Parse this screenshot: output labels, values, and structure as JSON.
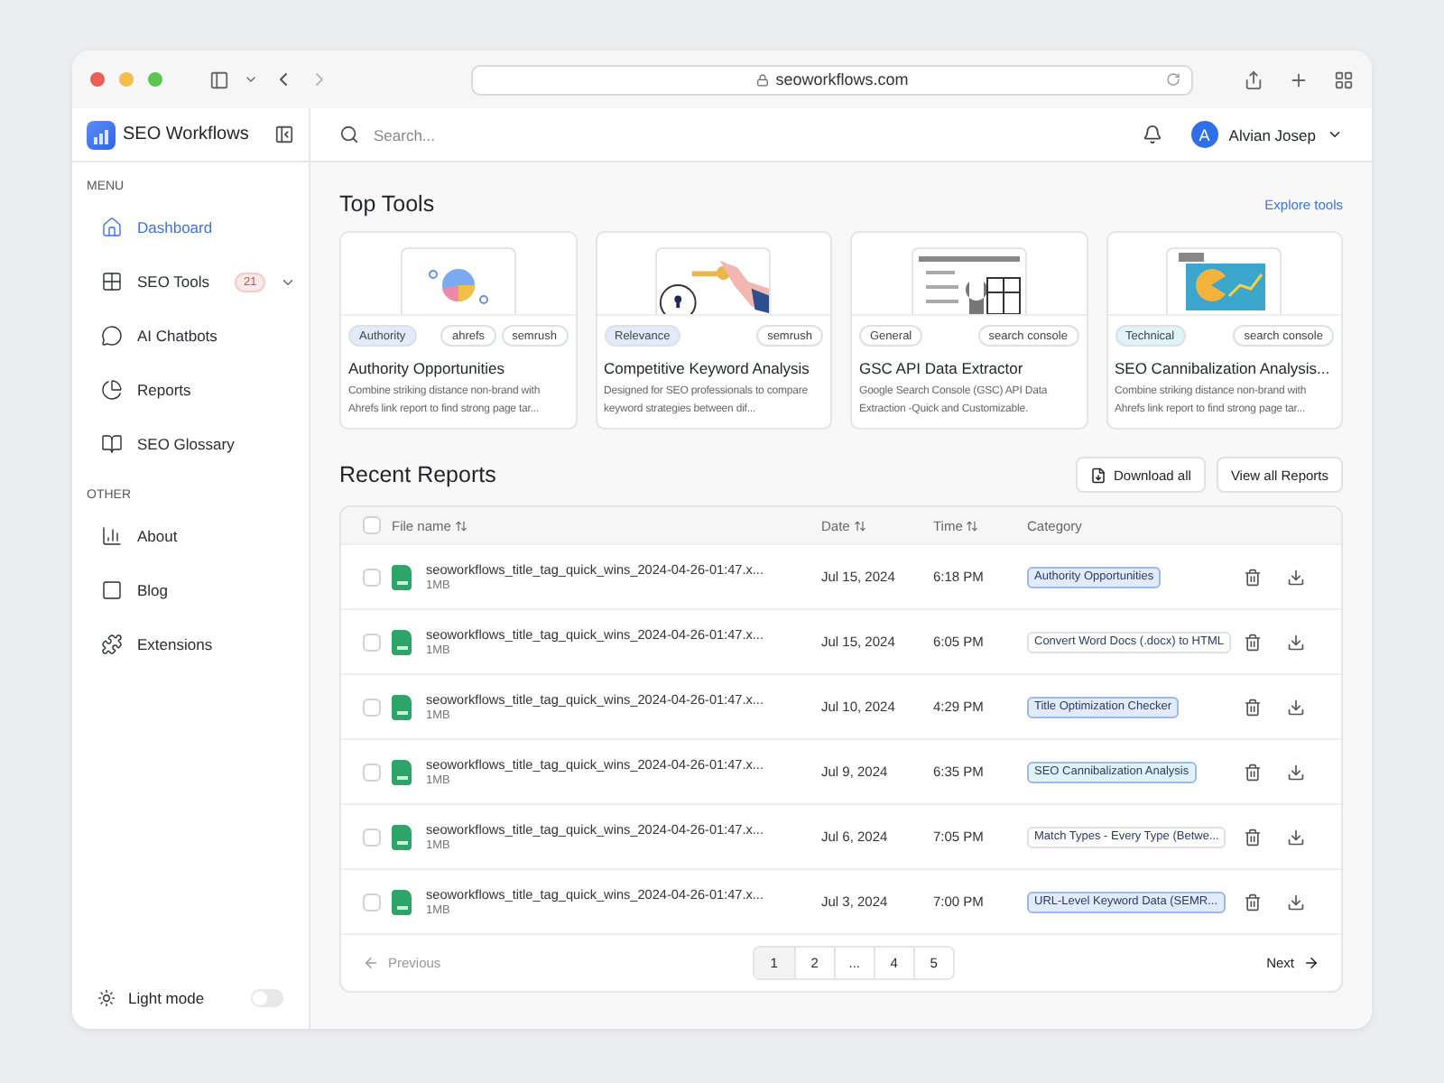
{
  "browser": {
    "url": "seoworkflows.com"
  },
  "sidebar": {
    "brand": "SEO Workflows",
    "sections": [
      {
        "heading": "MENU",
        "items": [
          {
            "label": "Dashboard",
            "selected": true
          },
          {
            "label": "SEO Tools",
            "selected": false,
            "badge": "21",
            "expandable": true
          },
          {
            "label": "AI Chatbots",
            "selected": false
          },
          {
            "label": "Reports",
            "selected": false
          },
          {
            "label": "SEO Glossary",
            "selected": false
          }
        ]
      },
      {
        "heading": "OTHER",
        "items": [
          {
            "label": "About",
            "selected": false
          },
          {
            "label": "Blog",
            "selected": false
          },
          {
            "label": "Extensions",
            "selected": false
          }
        ]
      }
    ],
    "theme": {
      "label": "Light mode",
      "on": false
    }
  },
  "topbar": {
    "search": {
      "placeholder": "Search..."
    },
    "user": {
      "initial": "A",
      "name": "Alvian Josep"
    }
  },
  "top_tools": {
    "title": "Top Tools",
    "link": "Explore tools",
    "cards": [
      {
        "kind": "chart",
        "tags": [
          {
            "label": "Authority",
            "color": "#e2ebfb"
          },
          {
            "label": "ahrefs",
            "color": "#ffffff"
          },
          {
            "label": "semrush",
            "color": "#ffffff"
          }
        ],
        "title": "Authority Opportunities",
        "description": "Combine striking distance non-brand with Ahrefs link report to find strong page tar..."
      },
      {
        "kind": "key",
        "tags": [
          {
            "label": "Relevance",
            "color": "#e2ebfb"
          },
          {
            "label": "semrush",
            "color": "#ffffff"
          }
        ],
        "title": "Competitive Keyword Analysis",
        "description": "Designed for SEO professionals to compare keyword strategies between dif..."
      },
      {
        "kind": "tools",
        "tags": [
          {
            "label": "General",
            "color": "#ffffff"
          },
          {
            "label": "search console",
            "color": "#ffffff"
          }
        ],
        "title": "GSC API Data Extractor",
        "description": "Google Search Console (GSC) API Data Extraction -Quick and Customizable."
      },
      {
        "kind": "game",
        "tags": [
          {
            "label": "Technical",
            "color": "#e0f3f8"
          },
          {
            "label": "search console",
            "color": "#ffffff"
          }
        ],
        "title": "SEO Cannibalization Analysis...",
        "description": "Combine striking distance non-brand with Ahrefs link report to find strong page tar..."
      }
    ]
  },
  "recent_reports": {
    "title": "Recent Reports",
    "buttons": [
      "Download all",
      "View all Reports"
    ],
    "select_all": {
      "checked": false
    },
    "columns": [
      "File name",
      "Date",
      "Time",
      "Category"
    ],
    "rows": [
      {
        "file": "seoworkflows_title_tag_quick_wins_2024-04-26-01:47.x...",
        "size": "1MB",
        "date": "Jul 15, 2024",
        "time": "6:18 PM",
        "category": "Authority Opportunities",
        "color": "#e2ebfb",
        "checked": false
      },
      {
        "file": "seoworkflows_title_tag_quick_wins_2024-04-26-01:47.x...",
        "size": "1MB",
        "date": "Jul 15, 2024",
        "time": "6:05 PM",
        "category": "Convert Word Docs (.docx) to HTML",
        "color": "#ffffff",
        "checked": false
      },
      {
        "file": "seoworkflows_title_tag_quick_wins_2024-04-26-01:47.x...",
        "size": "1MB",
        "date": "Jul 10, 2024",
        "time": "4:29 PM",
        "category": "Title Optimization Checker",
        "color": "#e2ebfb",
        "checked": false
      },
      {
        "file": "seoworkflows_title_tag_quick_wins_2024-04-26-01:47.x...",
        "size": "1MB",
        "date": "Jul 9, 2024",
        "time": "6:35 PM",
        "category": "SEO Cannibalization Analysis",
        "color": "#e0f3f8",
        "checked": false
      },
      {
        "file": "seoworkflows_title_tag_quick_wins_2024-04-26-01:47.x...",
        "size": "1MB",
        "date": "Jul 6, 2024",
        "time": "7:05 PM",
        "category": "Match Types - Every Type (Betwe...",
        "color": "#ffffff",
        "checked": false
      },
      {
        "file": "seoworkflows_title_tag_quick_wins_2024-04-26-01:47.x...",
        "size": "1MB",
        "date": "Jul 3, 2024",
        "time": "7:00 PM",
        "category": "URL-Level Keyword Data (SEMR...",
        "color": "#e2ebfb",
        "checked": false
      }
    ],
    "pagination": {
      "previous": "Previous",
      "next": "Next",
      "pages": [
        {
          "label": "1",
          "selected": true
        },
        {
          "label": "2",
          "selected": false
        },
        {
          "label": "...",
          "selected": false
        },
        {
          "label": "4",
          "selected": false
        },
        {
          "label": "5",
          "selected": false
        }
      ]
    }
  }
}
